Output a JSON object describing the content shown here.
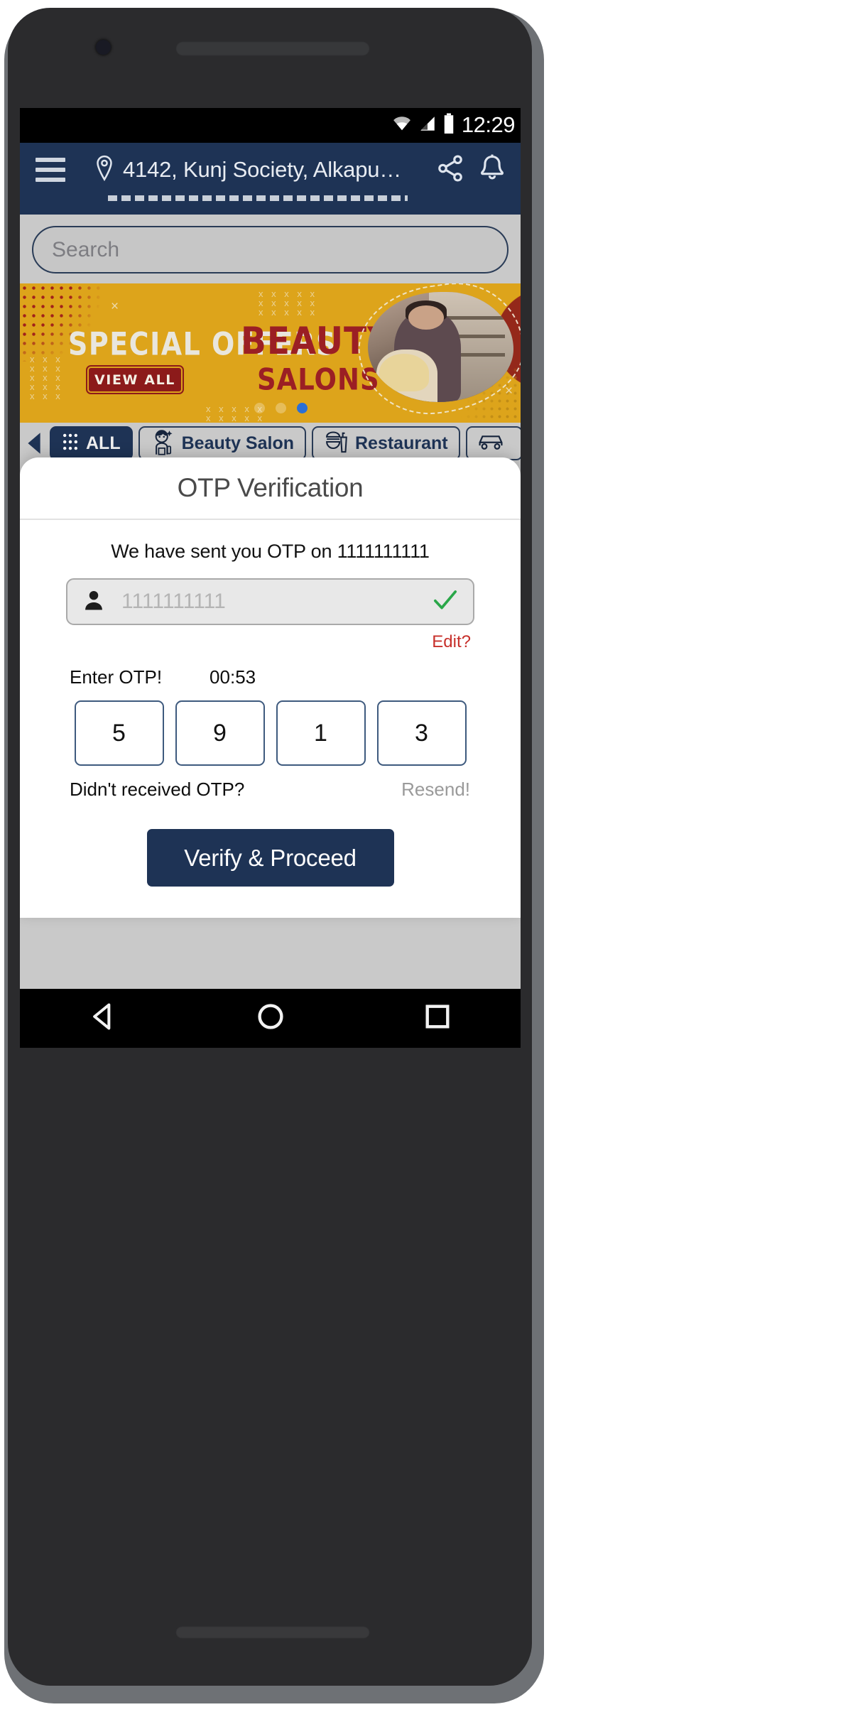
{
  "statusbar": {
    "time": "12:29",
    "icons": [
      "wifi-icon",
      "signal-icon",
      "battery-icon"
    ]
  },
  "appbar": {
    "menu_icon": "hamburger-menu-icon",
    "location_icon": "location-pin-icon",
    "address": "4142, Kunj Society, Alkapu…",
    "share_icon": "share-icon",
    "notification_icon": "bell-icon"
  },
  "search": {
    "placeholder": "Search",
    "value": ""
  },
  "banner": {
    "special_offers": "SPECIAL OFFERS",
    "view_all": "VIEW ALL",
    "beauty": "BEAUTY",
    "salons": "SALONS",
    "dots": [
      false,
      false,
      true
    ],
    "bg_color": "#dda41b",
    "accent_color": "#9b1f24",
    "active_dot_color": "#2a6fd6"
  },
  "categories": {
    "prev_icon": "chevron-left-icon",
    "next_icon": "chevron-right-icon",
    "items": [
      {
        "label": "ALL",
        "icon": "grid-dots-icon",
        "active": true
      },
      {
        "label": "Beauty Salon",
        "icon": "beautician-icon",
        "active": false
      },
      {
        "label": "Restaurant",
        "icon": "food-drink-icon",
        "active": false
      },
      {
        "label": "",
        "icon": "car-icon",
        "active": false
      }
    ]
  },
  "modal": {
    "title": "OTP Verification",
    "sent_text": "We have sent you OTP on 1111111111",
    "phone_field": {
      "icon": "person-icon",
      "value": "1111111111",
      "placeholder": "1111111111",
      "valid_icon": "check-icon",
      "valid_color": "#2aa749"
    },
    "edit_label": "Edit?",
    "edit_color": "#c7302b",
    "enter_otp_label": "Enter OTP!",
    "timer": "00:53",
    "otp_digits": [
      "5",
      "9",
      "1",
      "3"
    ],
    "didnt_receive_label": "Didn't received OTP?",
    "resend_label": "Resend!",
    "verify_label": "Verify & Proceed",
    "primary_color": "#1e3355"
  },
  "navbar": {
    "back_icon": "back-triangle-icon",
    "home_icon": "home-circle-icon",
    "recents_icon": "recents-square-icon"
  }
}
